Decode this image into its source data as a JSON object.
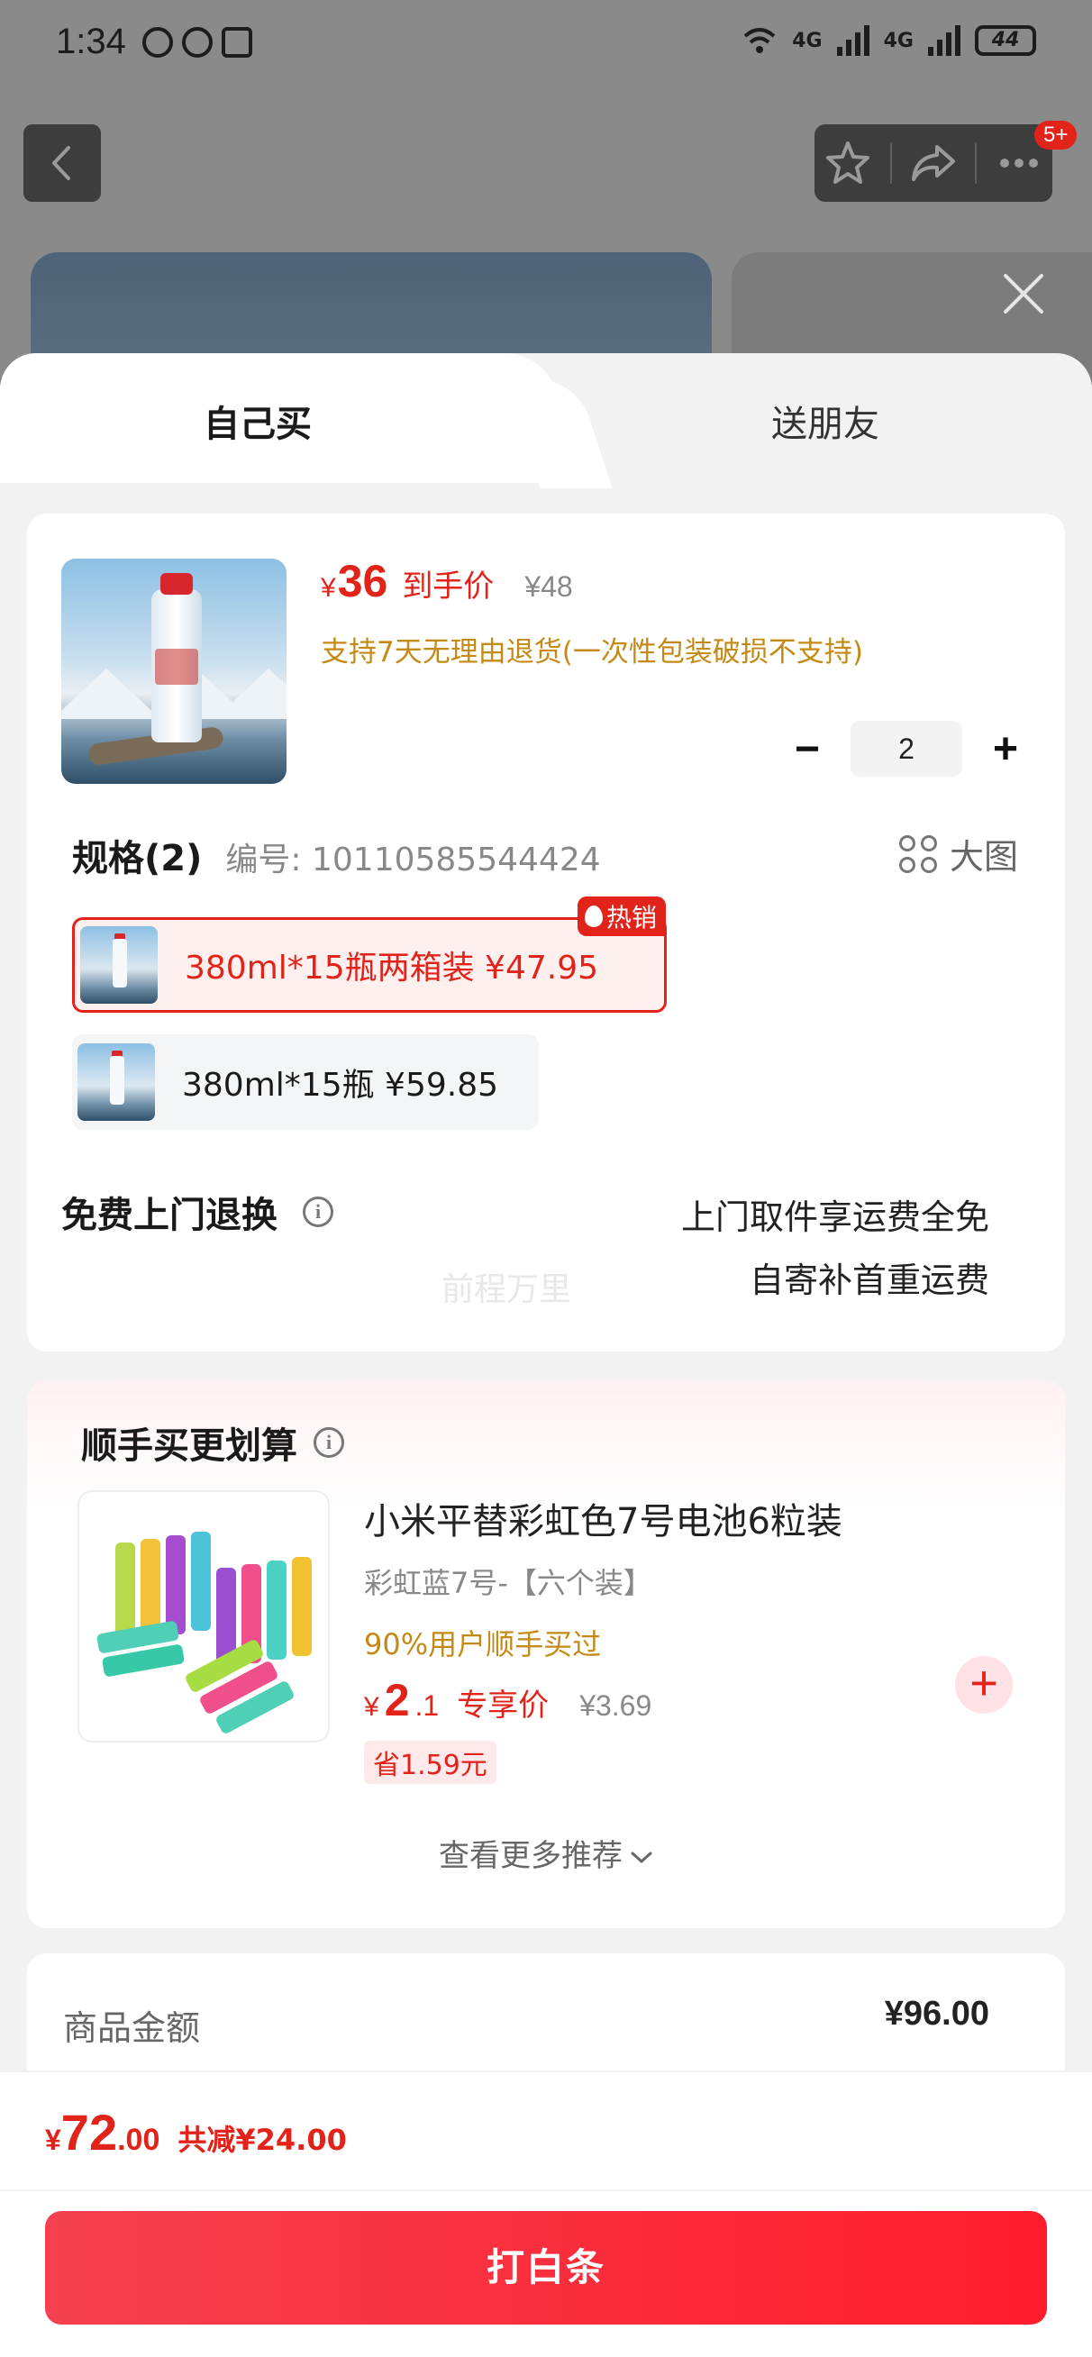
{
  "status_bar": {
    "time": "1:34",
    "network_a": "4G",
    "network_b": "4G",
    "battery": "44"
  },
  "nav": {
    "badge": "5+"
  },
  "tabs": {
    "self_buy": "自己买",
    "gift_friend": "送朋友"
  },
  "product": {
    "price_symbol": "¥",
    "price": "36",
    "price_tag": "到手价",
    "original_price": "¥48",
    "return_policy": "支持7天无理由退货(一次性包装破损不支持)",
    "quantity": "2",
    "minus": "−",
    "plus": "+"
  },
  "spec": {
    "title": "规格(2)",
    "code": "编号: 10110585544424",
    "big_image": "大图",
    "options": [
      {
        "label": "380ml*15瓶两箱装  ¥47.95",
        "badge": "热销",
        "selected": true
      },
      {
        "label": "380ml*15瓶  ¥59.85",
        "selected": false
      }
    ]
  },
  "watermark": "前程万里",
  "free_return": {
    "title": "免费上门退换",
    "info": "i",
    "line1": "上门取件享运费全免",
    "line2": "自寄补首重运费"
  },
  "upsell": {
    "title": "顺手买更划算",
    "info": "i",
    "name": "小米平替彩虹色7号电池6粒装",
    "variant": "彩虹蓝7号-【六个装】",
    "social_proof": "90%用户顺手买过",
    "price_symbol": "¥",
    "price_int": "2",
    "price_dec": ".1",
    "price_tag": "专享价",
    "original_price": "¥3.69",
    "savings": "省1.59元",
    "add": "+",
    "more": "查看更多推荐"
  },
  "amount": {
    "label": "商品金额",
    "value": "¥96.00"
  },
  "footer": {
    "total_symbol": "¥",
    "total_int": "72",
    "total_dec": ".00",
    "saved": "共减¥24.00",
    "pay_button": "打白条"
  },
  "colors": {
    "accent": "#e2231a",
    "gold": "#c58a16"
  }
}
